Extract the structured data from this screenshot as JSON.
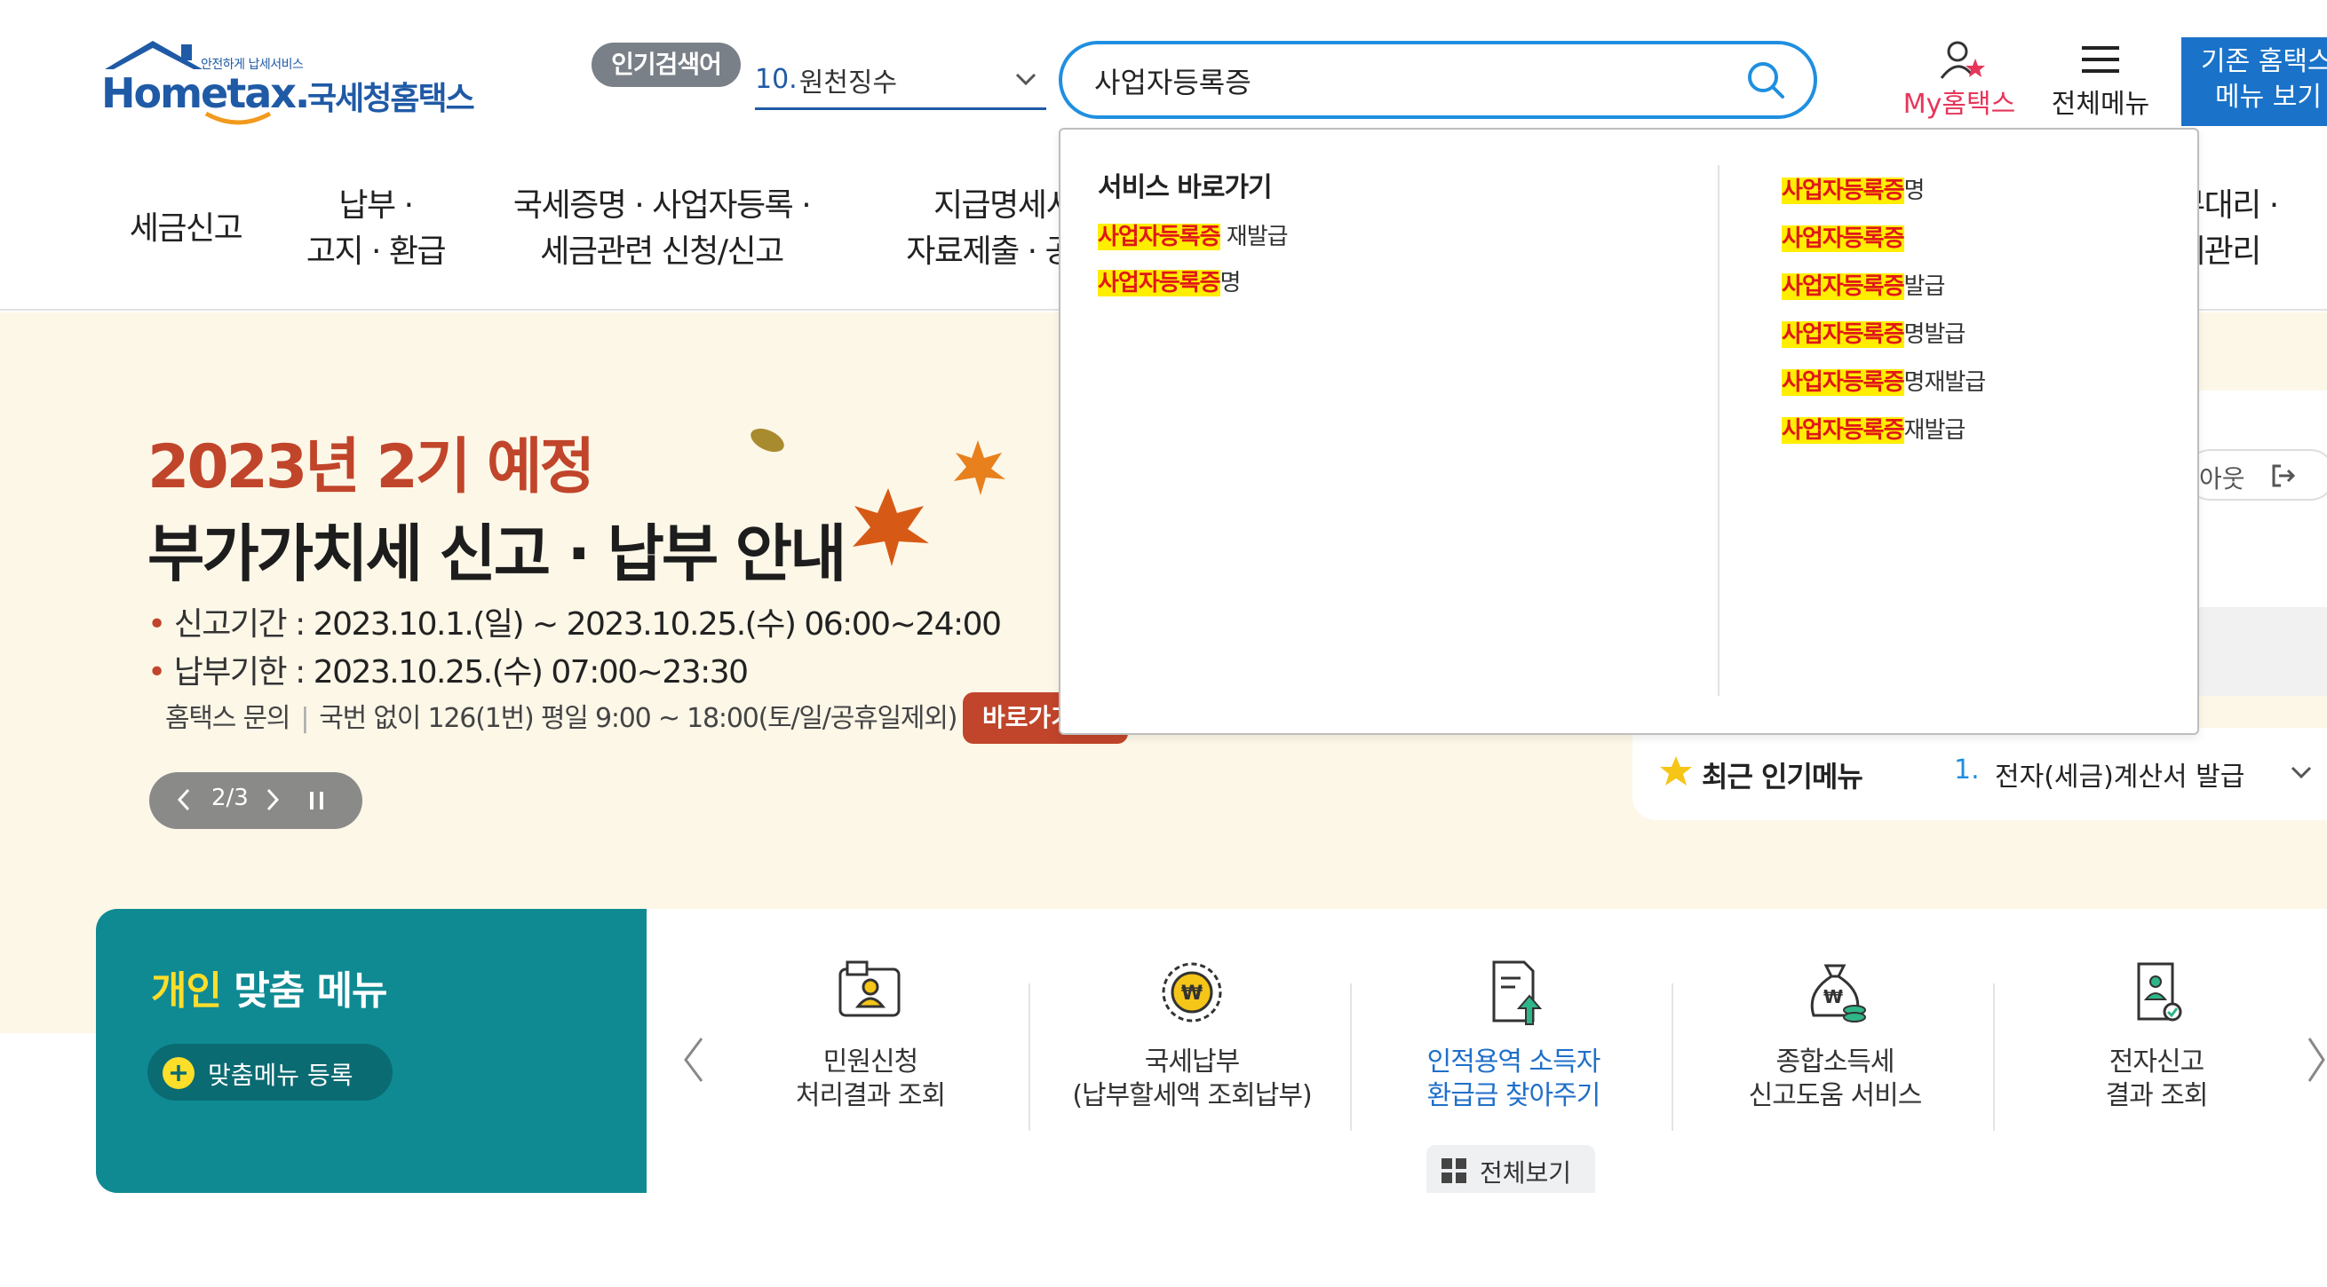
{
  "header": {
    "logo": {
      "tag": "안전하게 납세서비스",
      "brand": "Hometax.",
      "kor": "국세청홈택스"
    },
    "popular": {
      "badge": "인기검색어",
      "rank": "10.",
      "keyword": "원천징수"
    },
    "search": {
      "value": "사업자등록증",
      "placeholder": ""
    },
    "my_hometax": "My홈택스",
    "all_menu": "전체메뉴",
    "old_menu_line1": "기존 홈택스",
    "old_menu_line2": "메뉴 보기"
  },
  "nav": {
    "items": [
      {
        "line1": "세금신고",
        "line2": ""
      },
      {
        "line1": "납부 ·",
        "line2": "고지 · 환급"
      },
      {
        "line1": "국세증명 · 사업자등록 ·",
        "line2": "세금관련 신청/신고"
      },
      {
        "line1": "지급명세서",
        "line2": "자료제출 · 공익"
      },
      {
        "line1": "부대리 ·",
        "line2": "세관리"
      }
    ]
  },
  "dropdown": {
    "heading": "서비스 바로가기",
    "left_items": [
      {
        "hl": "사업자등록증",
        "rest": " 재발급"
      },
      {
        "hl": "사업자등록증",
        "rest": "명"
      }
    ],
    "right_items": [
      {
        "hl": "사업자등록증",
        "rest": "명"
      },
      {
        "hl": "사업자등록증",
        "rest": ""
      },
      {
        "hl": "사업자등록증",
        "rest": "발급"
      },
      {
        "hl": "사업자등록증",
        "rest": "명발급"
      },
      {
        "hl": "사업자등록증",
        "rest": "명재발급"
      },
      {
        "hl": "사업자등록증",
        "rest": "재발급"
      }
    ]
  },
  "banner": {
    "title1": "2023년 2기 예정",
    "title2": "부가가치세 신고 · 납부 안내",
    "line1_label": "신고기간 : ",
    "line1_value": "2023.10.1.(일) ~ 2023.10.25.(수) 06:00~24:00",
    "line2_label": "납부기한 : ",
    "line2_value": "2023.10.25.(수) 07:00~23:30",
    "contact_label": "홈택스 문의",
    "contact_value": "국번 없이 126(1번) 평일 9:00 ~ 18:00(토/일/공휴일제외)",
    "goto": "바로가기",
    "pager": "2/3"
  },
  "right_panel": {
    "logout": "아웃",
    "recent_title": "최근 인기메뉴",
    "recent_rank": "1.",
    "recent_value": "전자(세금)계산서 발급"
  },
  "personal_menu": {
    "title_highlight": "개인",
    "title_rest": " 맞춤 메뉴",
    "register": "맞춤메뉴 등록",
    "services": [
      {
        "line1": "민원신청",
        "line2": "처리결과 조회"
      },
      {
        "line1": "국세납부",
        "line2": "(납부할세액 조회납부)"
      },
      {
        "line1": "인적용역 소득자",
        "line2": "환급금 찾아주기"
      },
      {
        "line1": "종합소득세",
        "line2": "신고도움 서비스"
      },
      {
        "line1": "전자신고",
        "line2": "결과 조회"
      }
    ],
    "view_all": "전체보기"
  },
  "colors": {
    "brand_blue": "#1f5aa6",
    "accent_red": "#c0452a",
    "teal": "#0f8a93",
    "highlight_yellow": "#ffee00",
    "highlight_text": "#e01818",
    "mytax_pink": "#e6365a"
  }
}
